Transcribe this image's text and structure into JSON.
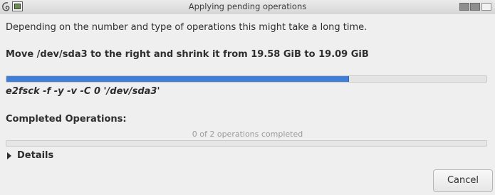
{
  "window": {
    "title": "Applying pending operations",
    "icons": {
      "system": "debian-swirl-icon",
      "app": "gparted-app-icon"
    },
    "controls": [
      "minimize-button",
      "maximize-button",
      "close-button"
    ]
  },
  "info_text": "Depending on the number and type of operations this might take a long time.",
  "current_operation": {
    "title": "Move /dev/sda3 to the right and shrink it from 19.58 GiB to 19.09 GiB",
    "progress_fraction": 0.714,
    "command": "e2fsck -f -y -v -C 0 '/dev/sda3'"
  },
  "completed": {
    "label": "Completed Operations:",
    "count_text": "0 of 2 operations completed",
    "progress_fraction": 0
  },
  "details": {
    "label": "Details",
    "expanded": false
  },
  "buttons": {
    "cancel": "Cancel"
  },
  "colors": {
    "accent": "#3f7fd9",
    "background": "#efefef"
  }
}
